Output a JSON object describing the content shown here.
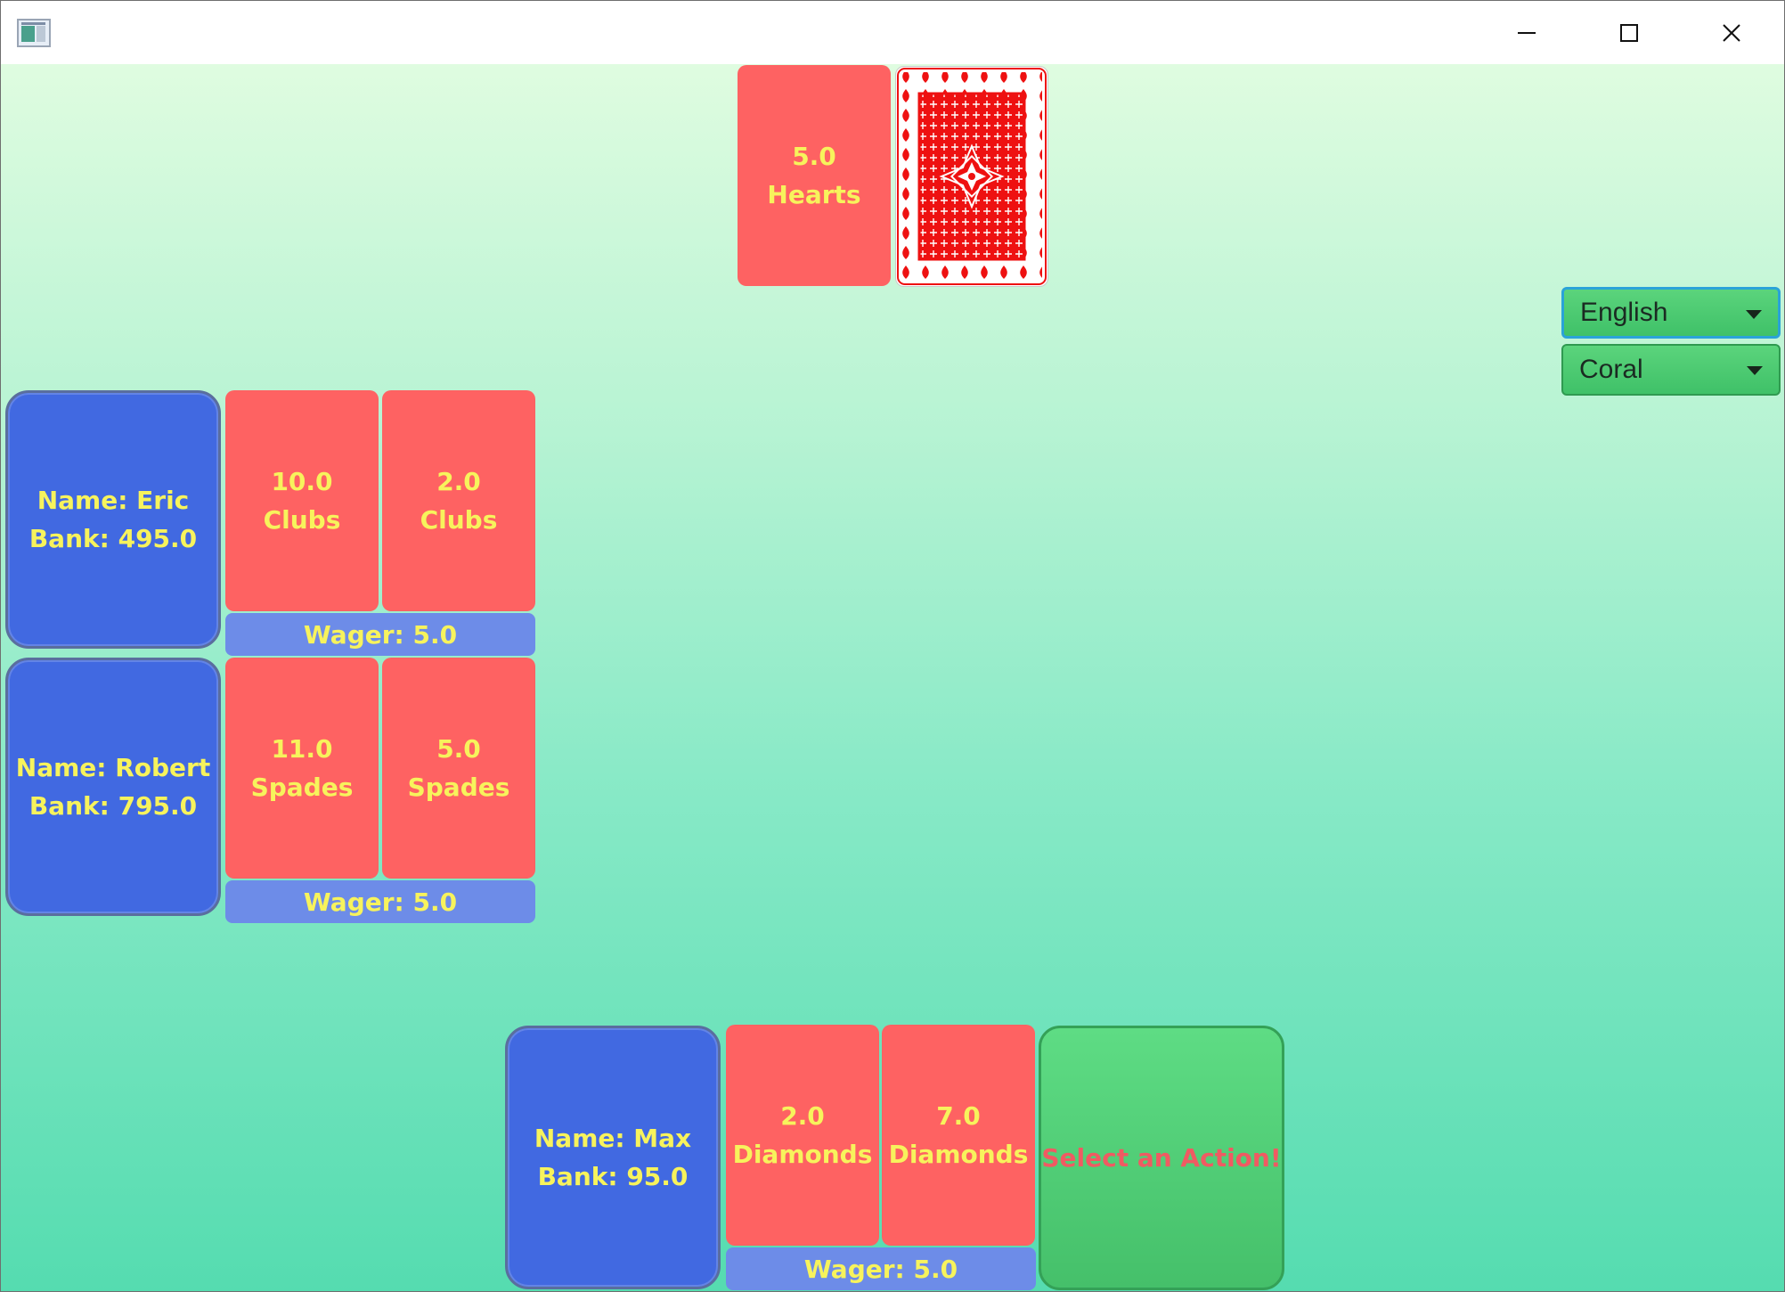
{
  "window": {
    "controls": {
      "minimize": "minimize-icon",
      "maximize": "maximize-icon",
      "close": "close-icon"
    }
  },
  "dealer": {
    "card": {
      "rank": "5.0",
      "suit": "Hearts"
    },
    "hidden_card": "card-back"
  },
  "selects": {
    "language": {
      "value": "English"
    },
    "theme": {
      "value": "Coral"
    }
  },
  "players": [
    {
      "name": "Name: Eric",
      "bank": "Bank: 495.0",
      "cards": [
        {
          "rank": "10.0",
          "suit": "Clubs"
        },
        {
          "rank": "2.0",
          "suit": "Clubs"
        }
      ],
      "wager": "Wager: 5.0"
    },
    {
      "name": "Name: Robert",
      "bank": "Bank: 795.0",
      "cards": [
        {
          "rank": "11.0",
          "suit": "Spades"
        },
        {
          "rank": "5.0",
          "suit": "Spades"
        }
      ],
      "wager": "Wager: 5.0"
    },
    {
      "name": "Name: Max",
      "bank": "Bank: 95.0",
      "cards": [
        {
          "rank": "2.0",
          "suit": "Diamonds"
        },
        {
          "rank": "7.0",
          "suit": "Diamonds"
        }
      ],
      "wager": "Wager: 5.0"
    }
  ],
  "action_button": "Select an Action!",
  "colors": {
    "card": "#fe6262",
    "card_text": "#f7f35c",
    "player": "#4169e1",
    "wager": "#6d8ce8",
    "action": "#4fcd75",
    "action_text": "#f05a62"
  }
}
